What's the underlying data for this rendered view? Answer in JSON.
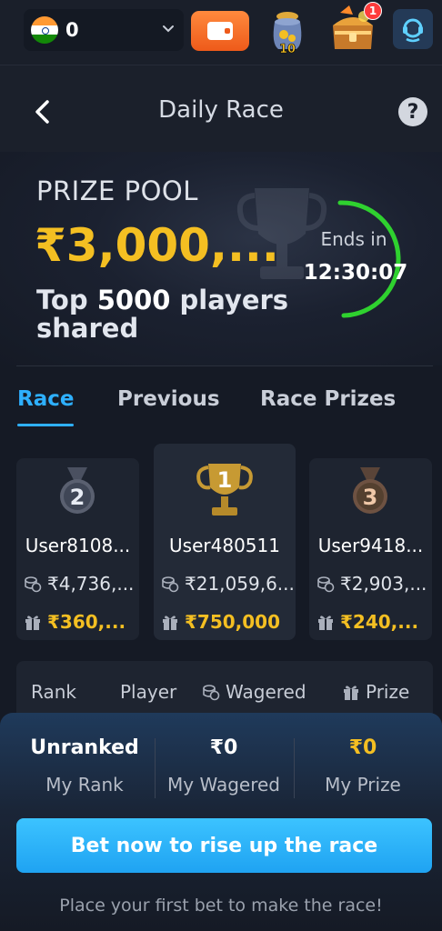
{
  "topbar": {
    "balance": "0",
    "jar_badge": "10",
    "notification_count": "1"
  },
  "header": {
    "title": "Daily Race"
  },
  "prize_pool": {
    "label": "PRIZE POOL",
    "amount": "₹3,000,...",
    "players_prefix": "Top ",
    "players_count": "5000",
    "players_suffix": " players shared",
    "ends_label": "Ends in",
    "timer": "12:30:07"
  },
  "tabs": [
    {
      "label": "Race",
      "active": true
    },
    {
      "label": "Previous",
      "active": false
    },
    {
      "label": "Race Prizes",
      "active": false
    }
  ],
  "podium": [
    {
      "rank": "2",
      "user": "User8108...",
      "wagered": "₹4,736,...",
      "prize": "₹360,..."
    },
    {
      "rank": "1",
      "user": "User480511",
      "wagered": "₹21,059,6...",
      "prize": "₹750,000"
    },
    {
      "rank": "3",
      "user": "User9418...",
      "wagered": "₹2,903,...",
      "prize": "₹240,..."
    }
  ],
  "table": {
    "headers": {
      "rank": "Rank",
      "player": "Player",
      "wagered": "Wagered",
      "prize": "Prize"
    }
  },
  "my_stats": {
    "rank_value": "Unranked",
    "rank_label": "My Rank",
    "wagered_value": "₹0",
    "wagered_label": "My Wagered",
    "prize_value": "₹0",
    "prize_label": "My Prize"
  },
  "cta": {
    "button": "Bet now to rise up the race",
    "hint": "Place your first bet to make the race!"
  },
  "colors": {
    "accent": "#2eb0ff",
    "gold": "#f4bf22",
    "timer_ring": "#2fd12f",
    "background": "#151a25"
  }
}
